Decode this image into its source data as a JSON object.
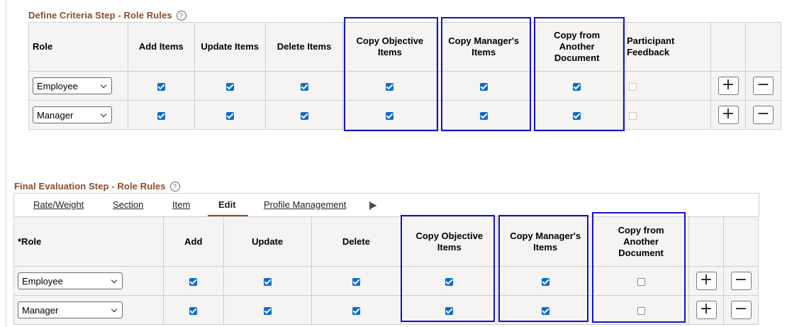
{
  "section1": {
    "title": "Define Criteria Step - Role Rules",
    "help": "?",
    "headers": [
      "Role",
      "Add Items",
      "Update Items",
      "Delete Items",
      "Copy Objective Items",
      "Copy Manager's Items",
      "Copy from Another Document",
      "Participant Feedback"
    ],
    "rows": [
      {
        "role": "Employee",
        "checks": [
          true,
          true,
          true,
          true,
          true,
          true
        ],
        "feedback": false
      },
      {
        "role": "Manager",
        "checks": [
          true,
          true,
          true,
          true,
          true,
          true
        ],
        "feedback": false
      }
    ],
    "add_label": "+",
    "remove_label": "−"
  },
  "section2": {
    "title": "Final Evaluation Step - Role Rules",
    "help": "?",
    "tabs": [
      {
        "label": "Rate/Weight",
        "active": false
      },
      {
        "label": "Section",
        "active": false
      },
      {
        "label": "Item",
        "active": false
      },
      {
        "label": "Edit",
        "active": true
      },
      {
        "label": "Profile Management",
        "active": false
      }
    ],
    "more_tabs": "||▶",
    "headers": [
      "*Role",
      "Add",
      "Update",
      "Delete",
      "Copy Objective Items",
      "Copy Manager's Items",
      "Copy from Another Document"
    ],
    "rows": [
      {
        "role": "Employee",
        "checks": [
          true,
          true,
          true,
          true,
          true,
          false
        ]
      },
      {
        "role": "Manager",
        "checks": [
          true,
          true,
          true,
          true,
          true,
          false
        ]
      }
    ],
    "add_label": "+",
    "remove_label": "−"
  },
  "colors": {
    "title": "#8a4b2a",
    "highlight": "#1414c8",
    "checkbox": "#0b6bd3"
  }
}
